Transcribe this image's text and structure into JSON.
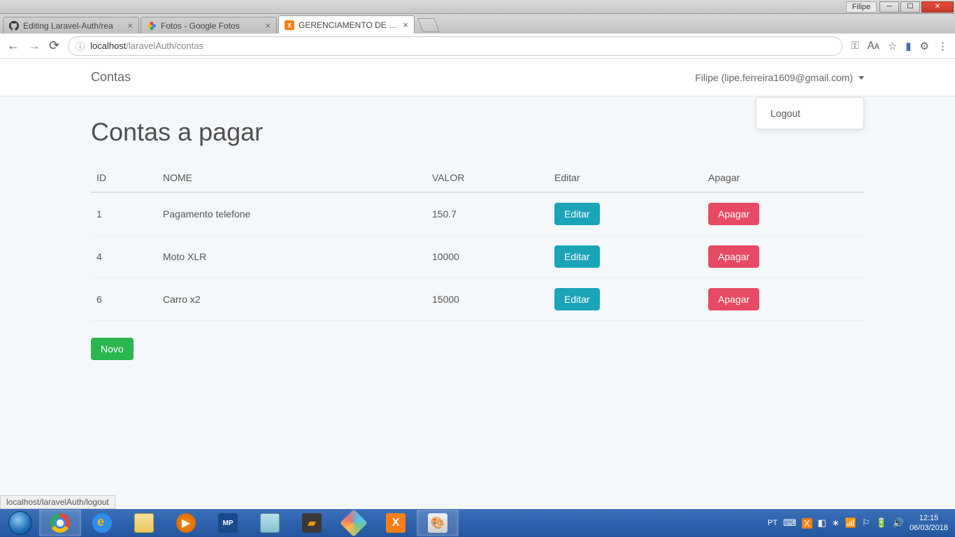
{
  "windows": {
    "user": "Filipe"
  },
  "tabs": [
    {
      "title": "Editing Laravel-Auth/rea",
      "active": false
    },
    {
      "title": "Fotos - Google Fotos",
      "active": false
    },
    {
      "title": "GERENCIAMENTO DE CO",
      "active": true
    }
  ],
  "url": {
    "host": "localhost",
    "path": "/laravelAuth/contas"
  },
  "navbar": {
    "brand": "Contas",
    "user": "Filipe (lipe.ferreira1609@gmail.com)",
    "dropdown": {
      "logout": "Logout"
    }
  },
  "page": {
    "title": "Contas a pagar",
    "columns": {
      "id": "ID",
      "nome": "NOME",
      "valor": "VALOR",
      "editar": "Editar",
      "apagar": "Apagar"
    },
    "rows": [
      {
        "id": "1",
        "nome": "Pagamento telefone",
        "valor": "150.7"
      },
      {
        "id": "4",
        "nome": "Moto XLR",
        "valor": "10000"
      },
      {
        "id": "6",
        "nome": "Carro x2",
        "valor": "15000"
      }
    ],
    "buttons": {
      "editar": "Editar",
      "apagar": "Apagar",
      "novo": "Novo"
    }
  },
  "status_bar": "localhost/laravelAuth/logout",
  "systray": {
    "lang": "PT",
    "time": "12:15",
    "date": "06/03/2018"
  }
}
